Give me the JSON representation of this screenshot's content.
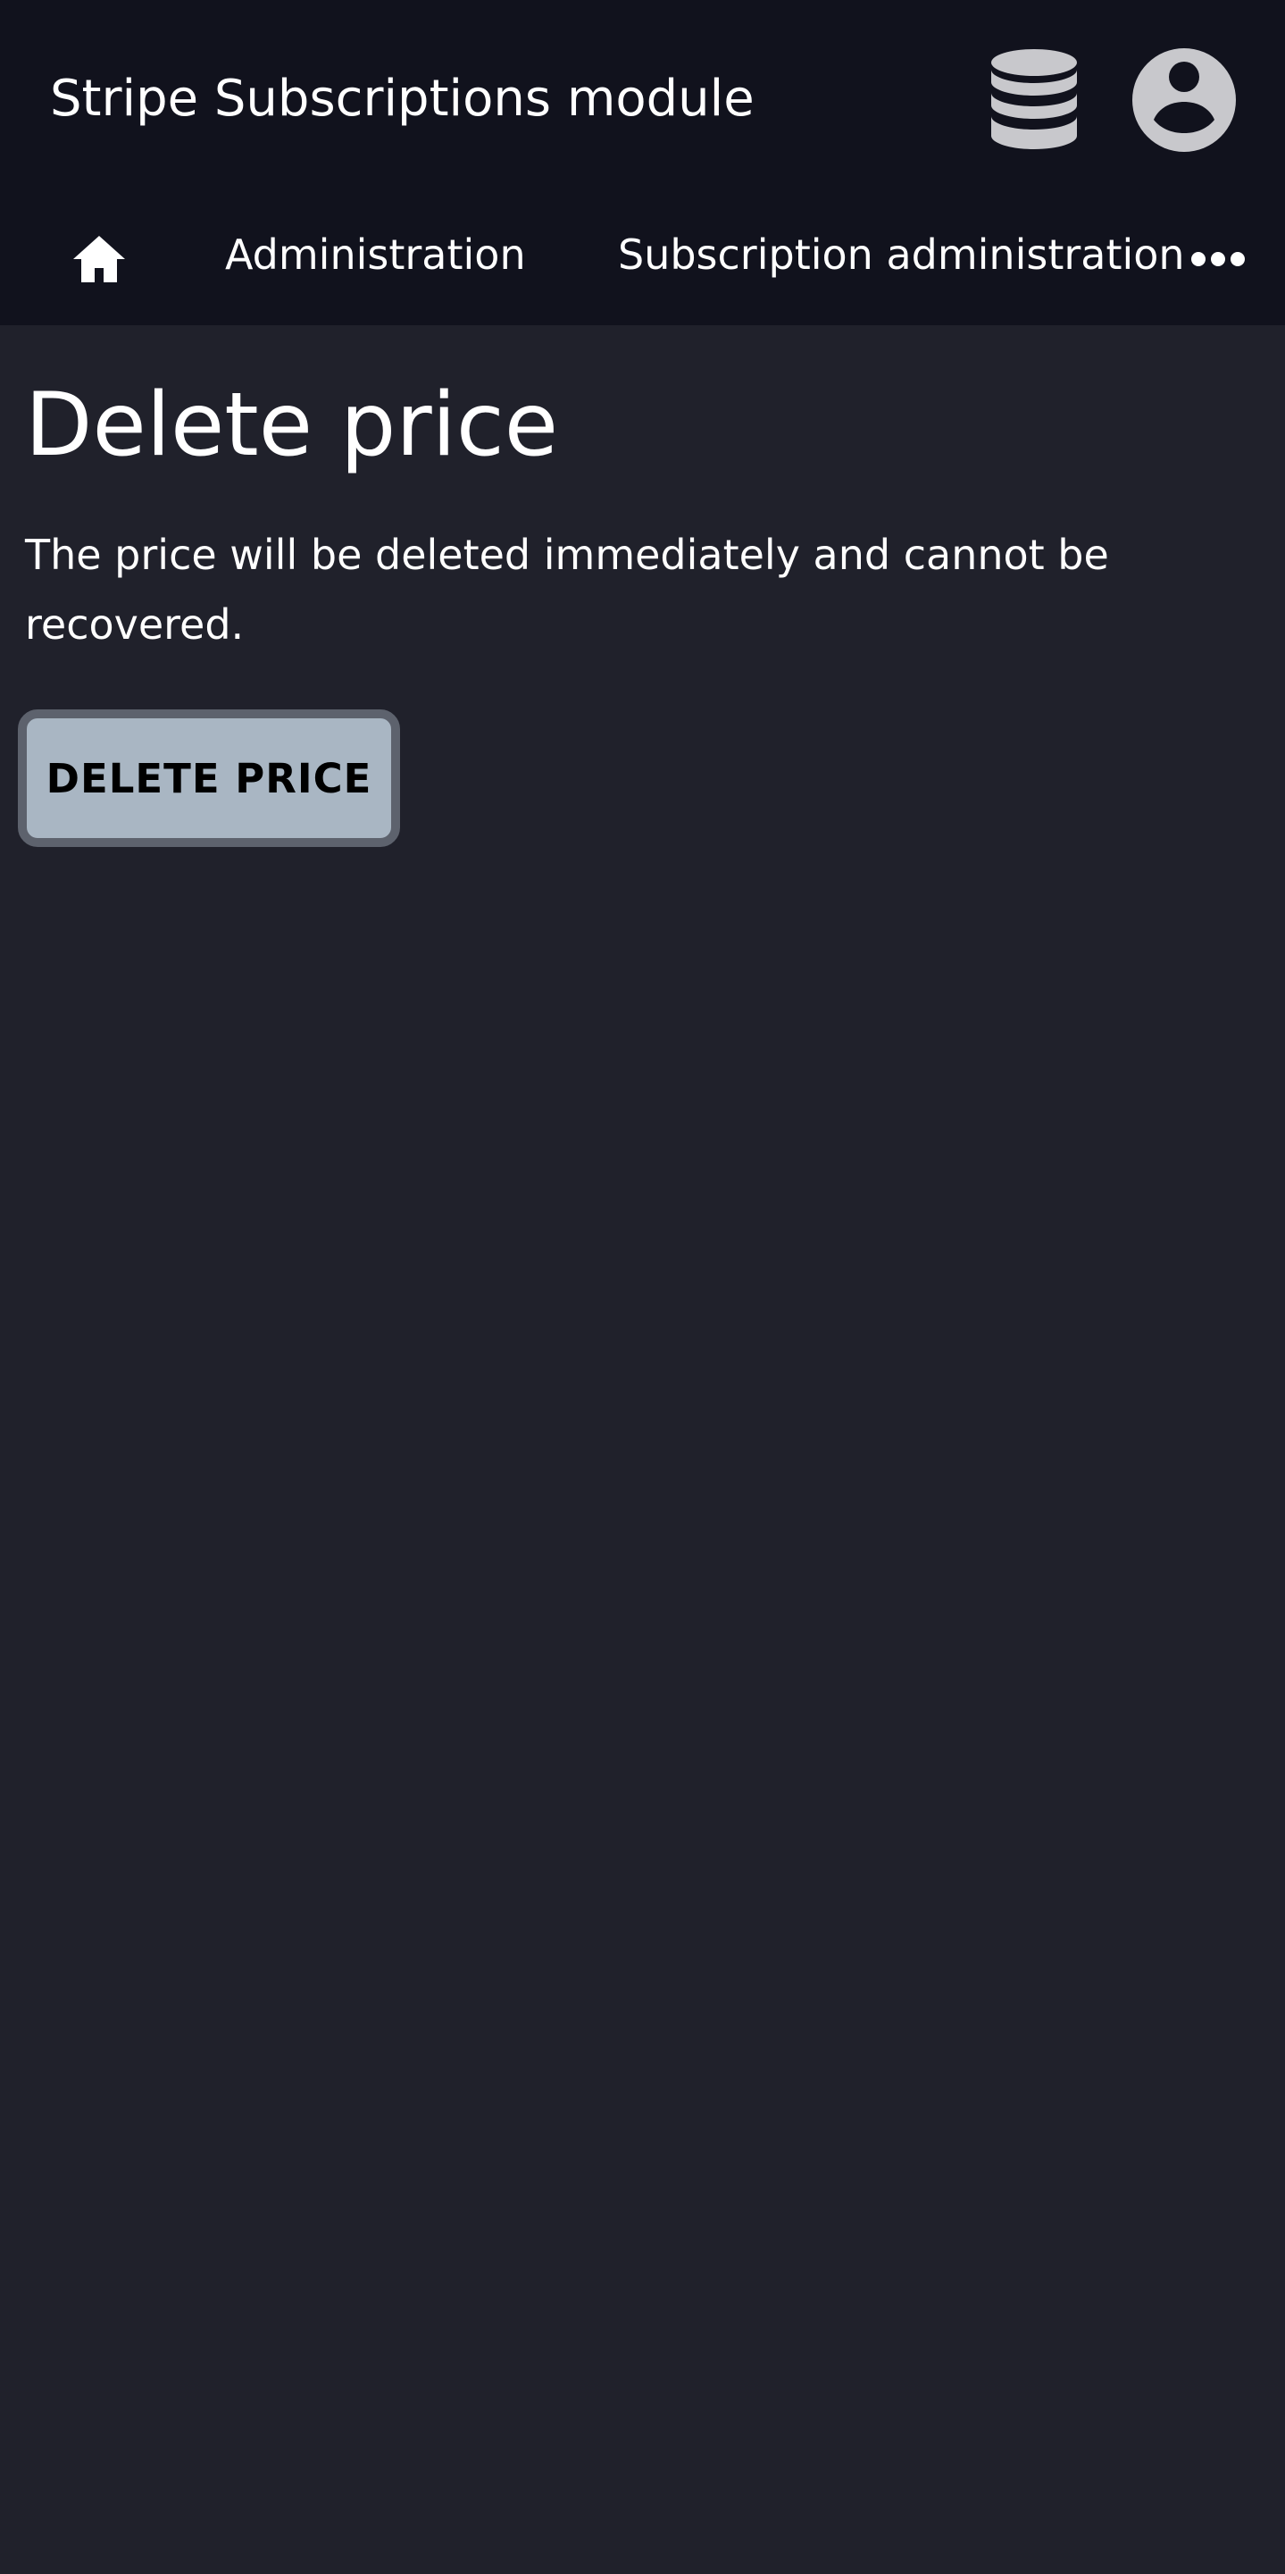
{
  "app": {
    "title": "Stripe Subscriptions module"
  },
  "header_icons": {
    "database": "database-icon",
    "account": "account-circle-icon"
  },
  "breadcrumb": {
    "home_icon": "home-icon",
    "items": [
      {
        "label": "Administration"
      },
      {
        "label": "Subscription administration"
      }
    ],
    "more_icon": "more-horizontal-icon"
  },
  "main": {
    "title": "Delete price",
    "description": "The price will be deleted immediately and cannot be recovered.",
    "delete_button_label": "DELETE PRICE"
  },
  "colors": {
    "header_bg": "#11121d",
    "page_bg": "#20212b",
    "button_bg": "#a9b6c3",
    "button_border": "#5d626d",
    "icon_gray": "#c8c8cc"
  }
}
